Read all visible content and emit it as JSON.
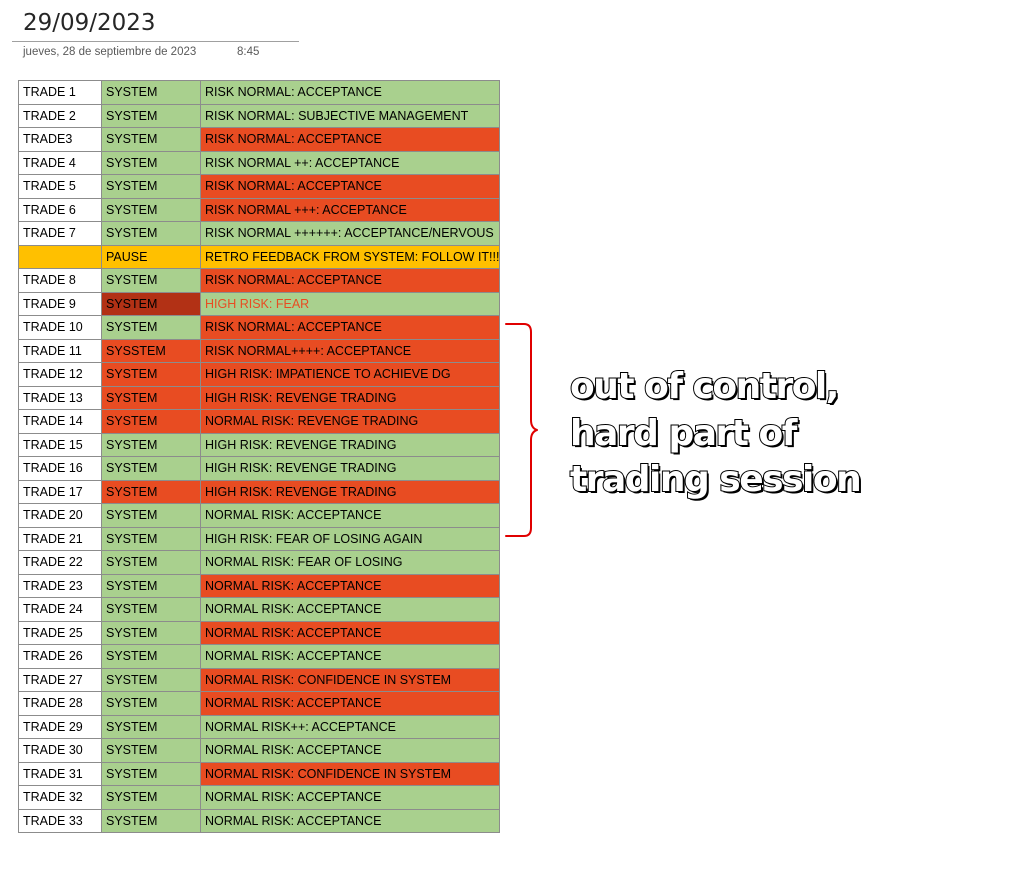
{
  "page": {
    "title": "29/09/2023",
    "date": "jueves, 28 de septiembre de 2023",
    "time": "8:45"
  },
  "colors": {
    "green": "#a9d08e",
    "red": "#e84c22",
    "yellow": "#ffc000",
    "dark_red": "#b23115",
    "white": "#ffffff"
  },
  "rows": [
    {
      "trade": "TRADE 1",
      "system": "SYSTEM",
      "note": "RISK NORMAL: ACCEPTANCE"
    },
    {
      "trade": "TRADE 2",
      "system": "SYSTEM",
      "note": "RISK NORMAL: SUBJECTIVE MANAGEMENT"
    },
    {
      "trade": "TRADE3",
      "system": "SYSTEM",
      "note": "RISK NORMAL: ACCEPTANCE"
    },
    {
      "trade": "TRADE 4",
      "system": "SYSTEM",
      "note": "RISK NORMAL ++: ACCEPTANCE"
    },
    {
      "trade": "TRADE 5",
      "system": "SYSTEM",
      "note": "RISK NORMAL: ACCEPTANCE"
    },
    {
      "trade": "TRADE 6",
      "system": "SYSTEM",
      "note": "RISK NORMAL +++: ACCEPTANCE"
    },
    {
      "trade": "TRADE 7",
      "system": "SYSTEM",
      "note": "RISK NORMAL ++++++: ACCEPTANCE/NERVOUS"
    },
    {
      "trade": "",
      "system": "PAUSE",
      "note": "RETRO FEEDBACK FROM SYSTEM: FOLLOW IT!!!"
    },
    {
      "trade": "TRADE 8",
      "system": "SYSTEM",
      "note": "RISK NORMAL: ACCEPTANCE"
    },
    {
      "trade": "TRADE 9",
      "system": "SYSTEM",
      "note": "HIGH RISK: FEAR"
    },
    {
      "trade": "TRADE 10",
      "system": "SYSTEM",
      "note": "RISK NORMAL: ACCEPTANCE"
    },
    {
      "trade": "TRADE 11",
      "system": "SYSSTEM",
      "note": "RISK NORMAL++++: ACCEPTANCE"
    },
    {
      "trade": "TRADE 12",
      "system": "SYSTEM",
      "note": "HIGH RISK: IMPATIENCE TO ACHIEVE DG"
    },
    {
      "trade": "TRADE 13",
      "system": "SYSTEM",
      "note": "HIGH RISK: REVENGE TRADING"
    },
    {
      "trade": "TRADE 14",
      "system": "SYSTEM",
      "note": "NORMAL RISK: REVENGE TRADING"
    },
    {
      "trade": "TRADE 15",
      "system": "SYSTEM",
      "note": "HIGH RISK: REVENGE TRADING"
    },
    {
      "trade": "TRADE 16",
      "system": "SYSTEM",
      "note": "HIGH RISK: REVENGE TRADING"
    },
    {
      "trade": "TRADE 17",
      "system": "SYSTEM",
      "note": "HIGH RISK: REVENGE TRADING"
    },
    {
      "trade": "TRADE 20",
      "system": "SYSTEM",
      "note": "NORMAL RISK: ACCEPTANCE"
    },
    {
      "trade": "TRADE 21",
      "system": "SYSTEM",
      "note": "HIGH RISK: FEAR OF LOSING AGAIN"
    },
    {
      "trade": "TRADE 22",
      "system": "SYSTEM",
      "note": "NORMAL RISK: FEAR OF LOSING"
    },
    {
      "trade": "TRADE 23",
      "system": "SYSTEM",
      "note": "NORMAL RISK: ACCEPTANCE"
    },
    {
      "trade": "TRADE 24",
      "system": "SYSTEM",
      "note": "NORMAL RISK: ACCEPTANCE"
    },
    {
      "trade": "TRADE 25",
      "system": "SYSTEM",
      "note": "NORMAL RISK: ACCEPTANCE"
    },
    {
      "trade": "TRADE 26",
      "system": "SYSTEM",
      "note": "NORMAL RISK: ACCEPTANCE"
    },
    {
      "trade": "TRADE 27",
      "system": "SYSTEM",
      "note": "NORMAL RISK: CONFIDENCE IN SYSTEM"
    },
    {
      "trade": "TRADE 28",
      "system": "SYSTEM",
      "note": "NORMAL RISK: ACCEPTANCE"
    },
    {
      "trade": "TRADE 29",
      "system": "SYSTEM",
      "note": "NORMAL RISK++: ACCEPTANCE"
    },
    {
      "trade": "TRADE 30",
      "system": "SYSTEM",
      "note": "NORMAL RISK: ACCEPTANCE"
    },
    {
      "trade": "TRADE 31",
      "system": "SYSTEM",
      "note": "NORMAL RISK: CONFIDENCE IN SYSTEM"
    },
    {
      "trade": "TRADE 32",
      "system": "SYSTEM",
      "note": "NORMAL RISK: ACCEPTANCE"
    },
    {
      "trade": "TRADE 33",
      "system": "SYSTEM",
      "note": "NORMAL RISK: ACCEPTANCE"
    }
  ],
  "annotation": {
    "lines": [
      "out of control,",
      "hard part of",
      "trading session"
    ],
    "brace_color": "#e00000"
  }
}
